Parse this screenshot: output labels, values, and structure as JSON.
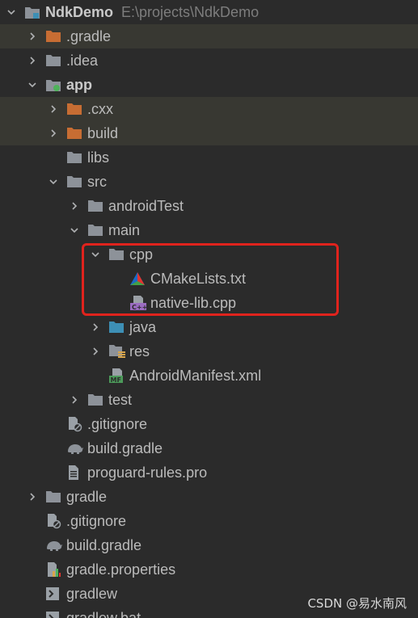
{
  "root": {
    "name": "NdkDemo",
    "path": "E:\\projects\\NdkDemo"
  },
  "items": {
    "gradle_dir": ".gradle",
    "idea_dir": ".idea",
    "app": "app",
    "cxx_dir": ".cxx",
    "build_dir": "build",
    "libs_dir": "libs",
    "src_dir": "src",
    "android_test_dir": "androidTest",
    "main_dir": "main",
    "cpp_dir": "cpp",
    "cmakelists": "CMakeLists.txt",
    "native_lib": "native-lib.cpp",
    "java_dir": "java",
    "res_dir": "res",
    "manifest": "AndroidManifest.xml",
    "test_dir": "test",
    "app_gitignore": ".gitignore",
    "app_build_gradle": "build.gradle",
    "proguard": "proguard-rules.pro",
    "gradle_root_dir": "gradle",
    "root_gitignore": ".gitignore",
    "root_build_gradle": "build.gradle",
    "gradle_properties": "gradle.properties",
    "gradlew": "gradlew",
    "gradlew_bat": "gradlew.bat"
  },
  "watermark": "CSDN @易水南风",
  "colors": {
    "background": "#2b2b2b",
    "excluded_row": "#383832",
    "highlight_border": "#e0231d",
    "folder_grey": "#8d9299",
    "folder_orange": "#c76d33",
    "folder_blue": "#3d8fb5"
  }
}
